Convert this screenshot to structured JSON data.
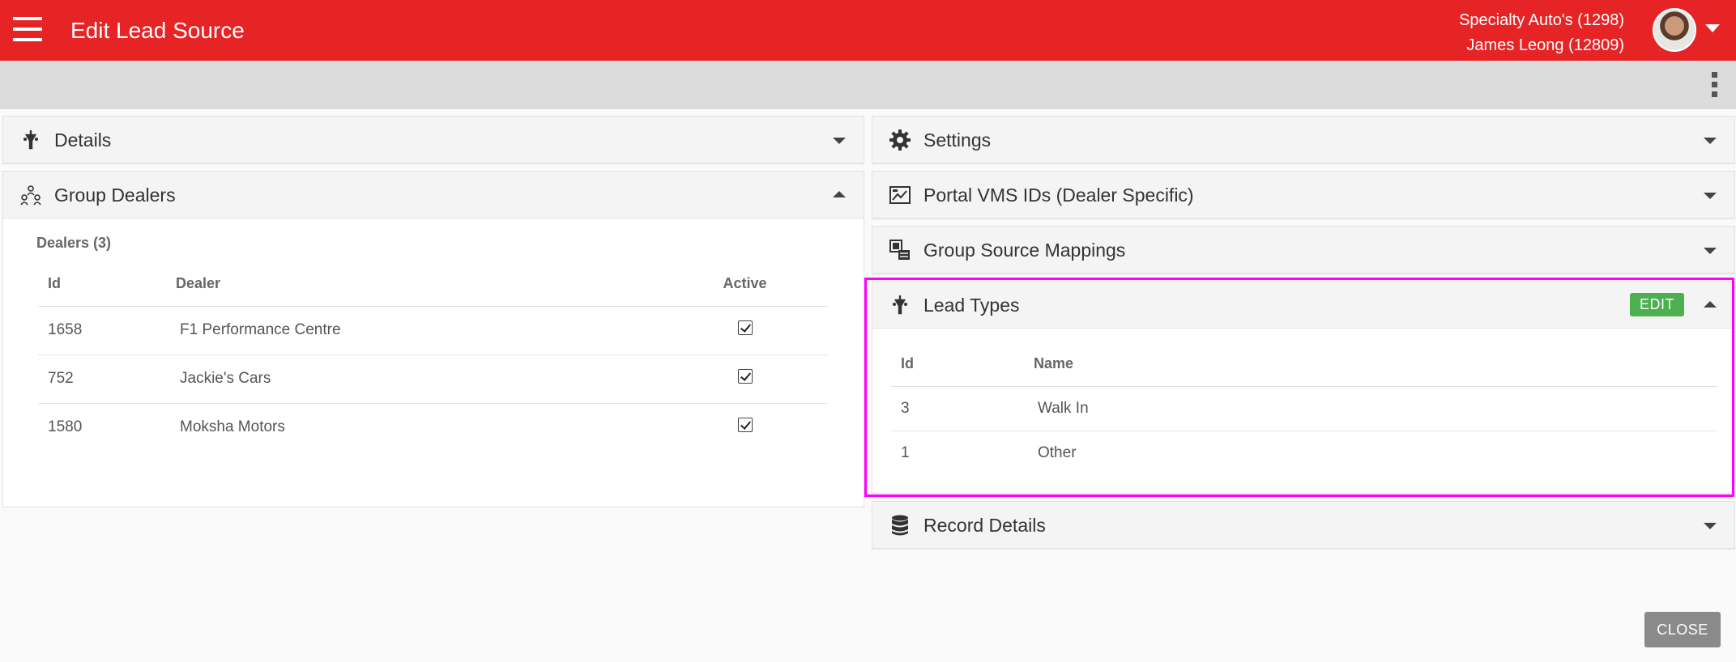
{
  "header": {
    "title": "Edit Lead Source",
    "dealer_line": "Specialty Auto's (1298)",
    "user_line": "James Leong (12809)",
    "accent_color": "#e62325"
  },
  "panels": {
    "details": {
      "title": "Details",
      "icon": "funnel-icon"
    },
    "group_dealers": {
      "title": "Group Dealers",
      "icon": "group-icon",
      "dealers_label": "Dealers (3)",
      "columns": {
        "id": "Id",
        "dealer": "Dealer",
        "active": "Active"
      },
      "rows": [
        {
          "id": "1658",
          "dealer": "F1 Performance Centre",
          "active": true
        },
        {
          "id": "752",
          "dealer": "Jackie's Cars",
          "active": true
        },
        {
          "id": "1580",
          "dealer": "Moksha Motors",
          "active": true
        }
      ]
    },
    "settings": {
      "title": "Settings",
      "icon": "gear-icon"
    },
    "portal_vms": {
      "title": "Portal VMS IDs (Dealer Specific)",
      "icon": "image-chart-icon"
    },
    "group_source_mappings": {
      "title": "Group Source Mappings",
      "icon": "mapping-icon"
    },
    "lead_types": {
      "title": "Lead Types",
      "icon": "funnel-icon",
      "edit_label": "EDIT",
      "columns": {
        "id": "Id",
        "name": "Name"
      },
      "rows": [
        {
          "id": "3",
          "name": "Walk In"
        },
        {
          "id": "1",
          "name": "Other"
        }
      ]
    },
    "record_details": {
      "title": "Record Details",
      "icon": "database-icon"
    }
  },
  "footer": {
    "close_label": "CLOSE"
  }
}
